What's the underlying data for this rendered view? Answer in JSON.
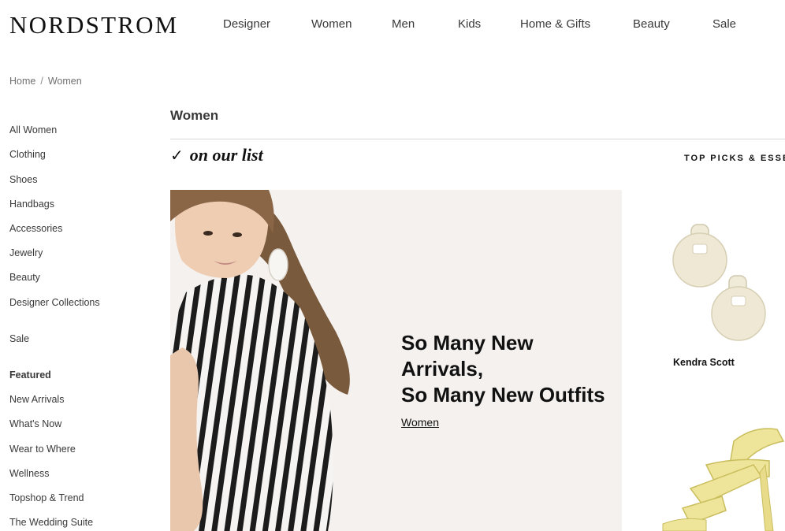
{
  "header": {
    "logo": "NORDSTROM",
    "nav": [
      "Designer",
      "Women",
      "Men",
      "Kids",
      "Home & Gifts",
      "Beauty",
      "Sale"
    ]
  },
  "breadcrumb": {
    "home": "Home",
    "separator": "/",
    "current": "Women"
  },
  "sidebar": {
    "categories": [
      "All Women",
      "Clothing",
      "Shoes",
      "Handbags",
      "Accessories",
      "Jewelry",
      "Beauty",
      "Designer Collections"
    ],
    "sale": "Sale",
    "featured_heading": "Featured",
    "featured": [
      "New Arrivals",
      "What's Now",
      "Wear to Where",
      "Wellness",
      "Topshop & Trend",
      "The Wedding Suite"
    ]
  },
  "main": {
    "title": "Women",
    "on_our_list": "on our list",
    "check_icon": "check-icon",
    "top_picks": "TOP PICKS & ESSE",
    "hero": {
      "headline_line1": "So Many New",
      "headline_line2": "Arrivals,",
      "headline_line3": "So Many New Outfits",
      "link": "Women"
    },
    "products": [
      {
        "brand": "Kendra Scott",
        "icon": "earrings-image"
      },
      {
        "brand": "",
        "icon": "yellow-sandal-image"
      }
    ]
  },
  "colors": {
    "text": "#393939",
    "black": "#111111",
    "divider": "#d8d8d8",
    "hero_bg": "#f4f1ef",
    "sandal": "#efe59a"
  }
}
